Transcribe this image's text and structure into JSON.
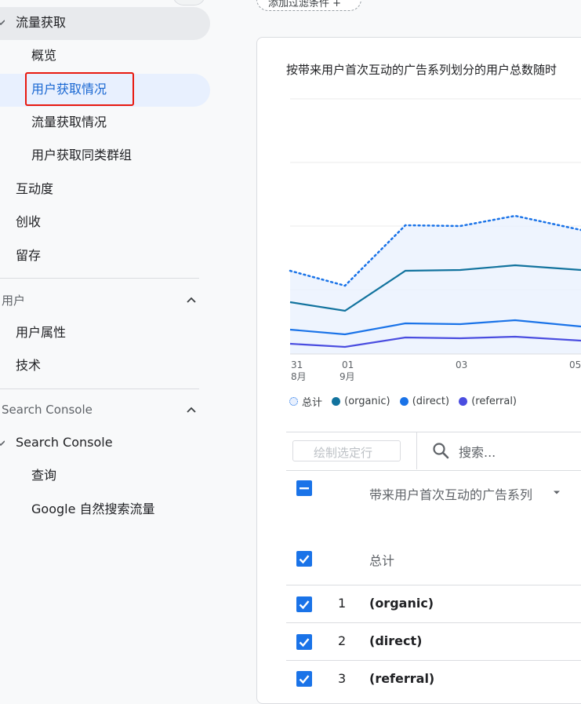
{
  "sidebar": {
    "group_acquisition": "流量获取",
    "acq_items": [
      "概览",
      "用户获取情况",
      "流量获取情况",
      "用户获取同类群组"
    ],
    "engagement": "互动度",
    "monetization": "创收",
    "retention": "留存",
    "user_section": "用户",
    "user_items": [
      "用户属性",
      "技术"
    ],
    "sc_section": "Search Console",
    "sc_group": "Search Console",
    "sc_items": [
      "查询",
      "Google 自然搜索流量"
    ]
  },
  "filter": {
    "label": "添加过滤条件 +"
  },
  "chart_title": "按带来用户首次互动的广告系列划分的用户总数随时",
  "chart_data": {
    "type": "line",
    "x_ticks": [
      {
        "day": "31",
        "month": "8月"
      },
      {
        "day": "01",
        "month": "9月"
      },
      {
        "day": "03",
        "month": ""
      },
      {
        "day": "05",
        "month": ""
      }
    ],
    "series": [
      {
        "name": "总计",
        "style": "dotted",
        "color": "#1a73e8"
      },
      {
        "name": "(organic)",
        "color": "#12739e"
      },
      {
        "name": "(direct)",
        "color": "#1a73e8"
      },
      {
        "name": "(referral)",
        "color": "#4a4de0"
      }
    ],
    "grid": true
  },
  "table": {
    "plot_button": "绘制选定行",
    "search_placeholder": "搜索...",
    "dimension_header": "带来用户首次互动的广告系列",
    "total_label": "总计",
    "rows": [
      {
        "index": "1",
        "name": "(organic)"
      },
      {
        "index": "2",
        "name": "(direct)"
      },
      {
        "index": "3",
        "name": "(referral)"
      }
    ]
  }
}
